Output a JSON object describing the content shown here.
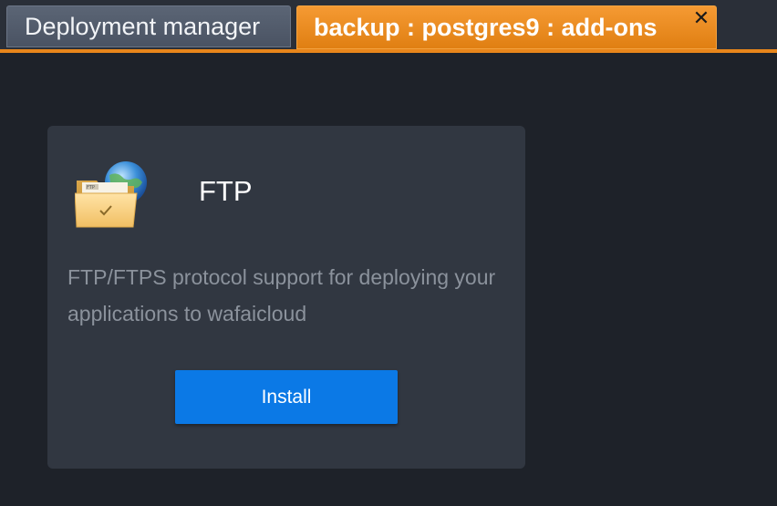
{
  "tabs": {
    "inactive_label": "Deployment manager",
    "active_label": "backup : postgres9 : add-ons",
    "close_glyph": "✕"
  },
  "addon": {
    "title": "FTP",
    "description": "FTP/FTPS protocol support for deploying your applications to wafaicloud",
    "icon": "ftp-folder-globe-icon",
    "icon_label": "FTP",
    "install_label": "Install"
  },
  "colors": {
    "active_tab": "#e8861b",
    "install_button": "#0b79e6",
    "background": "#1e2229",
    "card": "#313741"
  }
}
